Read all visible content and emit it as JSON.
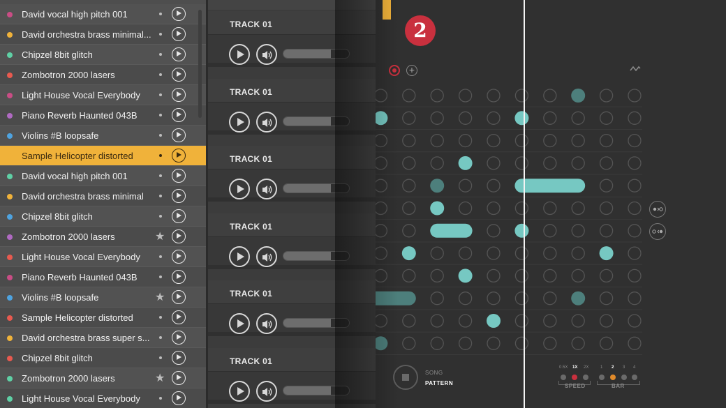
{
  "sequencer": {
    "badge": "2",
    "mode_song": "SONG",
    "mode_pattern": "PATTERN",
    "speed": {
      "options": [
        "0.5X",
        "1X",
        "2X"
      ],
      "selected": "1X",
      "label": "SPEED",
      "accent": "#c9303e"
    },
    "bar": {
      "options": [
        "1",
        "2",
        "3",
        "4"
      ],
      "selected": "2",
      "label": "BAR",
      "accent": "#e08a2a"
    },
    "note_color": "#76c8c2",
    "dim_note_color": "#4d7f7c"
  },
  "tracks": [
    {
      "name": "TRACK 01",
      "volume": 0.72
    },
    {
      "name": "TRACK 01",
      "volume": 0.72
    },
    {
      "name": "TRACK 01",
      "volume": 0.72
    },
    {
      "name": "TRACK 01",
      "volume": 0.72
    },
    {
      "name": "TRACK 01",
      "volume": 0.72
    },
    {
      "name": "TRACK 01",
      "volume": 0.72
    }
  ],
  "samples": [
    {
      "label": "David vocal high pitch 001",
      "color": "#c94d85",
      "mark": "dot"
    },
    {
      "label": "David orchestra brass minimal...",
      "color": "#f0b23a",
      "mark": "dot"
    },
    {
      "label": "Chipzel 8bit glitch",
      "color": "#5fd0a5",
      "mark": "dot"
    },
    {
      "label": "Zombotron 2000 lasers",
      "color": "#e85a4f",
      "mark": "dot"
    },
    {
      "label": "Light House Vocal Everybody",
      "color": "#c94d85",
      "mark": "dot"
    },
    {
      "label": "Piano Reverb Haunted 043B",
      "color": "#b06ac2",
      "mark": "dot"
    },
    {
      "label": "Violins #B loopsafe",
      "color": "#4ea3e0",
      "mark": "dot"
    },
    {
      "label": "Sample Helicopter distorted",
      "color": "#f0b23a",
      "mark": "dot",
      "selected": true
    },
    {
      "label": "David vocal high pitch 001",
      "color": "#5fd0a5",
      "mark": "dot"
    },
    {
      "label": "David orchestra brass minimal",
      "color": "#f0b23a",
      "mark": "dot"
    },
    {
      "label": "Chipzel 8bit glitch",
      "color": "#4ea3e0",
      "mark": "dot"
    },
    {
      "label": "Zombotron 2000 lasers",
      "color": "#b06ac2",
      "mark": "star"
    },
    {
      "label": "Light House Vocal Everybody",
      "color": "#e85a4f",
      "mark": "dot"
    },
    {
      "label": "Piano Reverb Haunted 043B",
      "color": "#c94d85",
      "mark": "dot"
    },
    {
      "label": "Violins #B loopsafe",
      "color": "#4ea3e0",
      "mark": "star"
    },
    {
      "label": "Sample Helicopter distorted",
      "color": "#e85a4f",
      "mark": "dot"
    },
    {
      "label": "David orchestra brass super s...",
      "color": "#f0b23a",
      "mark": "dot"
    },
    {
      "label": "Chipzel 8bit glitch",
      "color": "#e85a4f",
      "mark": "dot"
    },
    {
      "label": "Zombotron 2000 lasers",
      "color": "#5fd0a5",
      "mark": "star"
    },
    {
      "label": "Light House Vocal Everybody",
      "color": "#5fd0a5",
      "mark": "dot"
    }
  ]
}
